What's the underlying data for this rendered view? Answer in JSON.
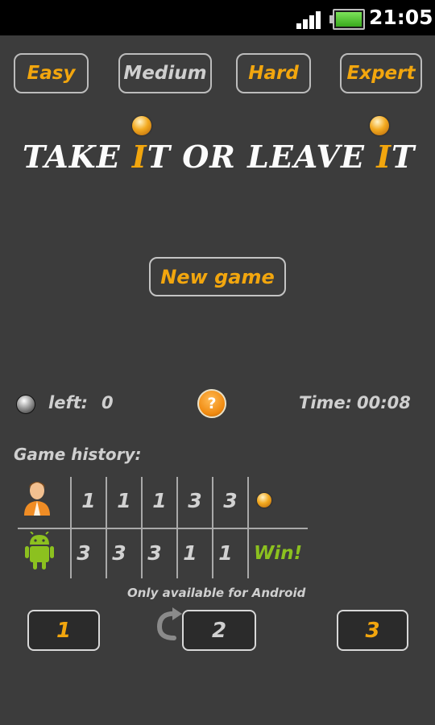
{
  "status_bar": {
    "time": "21:05",
    "icons": [
      "signal-icon",
      "battery-icon"
    ]
  },
  "levels": [
    {
      "label": "Easy",
      "active": true
    },
    {
      "label": "Medium",
      "active": false
    },
    {
      "label": "Hard",
      "active": true
    },
    {
      "label": "Expert",
      "active": true
    }
  ],
  "title": {
    "w1": "TAKE ",
    "w2": "I",
    "w3": "T OR LEAVE ",
    "w4": "I",
    "w5": "T"
  },
  "new_game_label": "New game",
  "info": {
    "left_label": "left:",
    "left_value": "0",
    "help_label": "?",
    "time_label": "Time:",
    "time_value": "00:08"
  },
  "history": {
    "title": "Game history:",
    "player_row": [
      "1",
      "1",
      "1",
      "3",
      "3"
    ],
    "android_row": [
      "3",
      "3",
      "3",
      "1",
      "1"
    ],
    "result": "Win!"
  },
  "only_android_label": "Only available for Android",
  "take_buttons": [
    "1",
    "2",
    "3"
  ],
  "colors": {
    "accent": "#f2a60e",
    "background": "#3c3c3c",
    "win": "#8cc11f"
  }
}
